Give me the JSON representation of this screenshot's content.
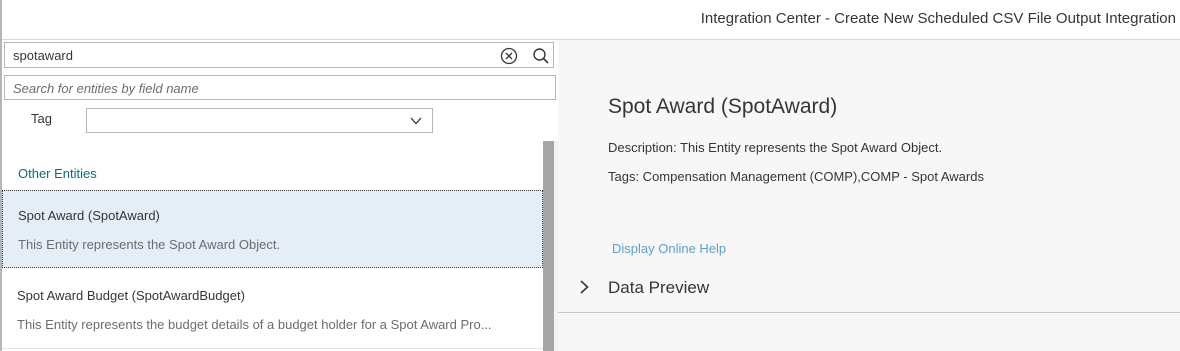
{
  "header": {
    "title": "Integration Center - Create New Scheduled CSV File Output Integration"
  },
  "search": {
    "value": "spotaward",
    "clear_icon": "clear-circle-icon",
    "search_icon": "search-icon"
  },
  "field_search": {
    "placeholder": "Search for entities by field name"
  },
  "tag_filter": {
    "label": "Tag",
    "value": "",
    "chevron_icon": "chevron-down-icon"
  },
  "list": {
    "section_header": "Other Entities",
    "items": [
      {
        "title": "Spot Award (SpotAward)",
        "description": "This Entity represents the Spot Award Object.",
        "selected": true
      },
      {
        "title": "Spot Award Budget (SpotAwardBudget)",
        "description": "This Entity represents the budget details of a budget holder for a Spot Award Pro...",
        "selected": false
      }
    ]
  },
  "detail": {
    "title": "Spot Award (SpotAward)",
    "description": "Description: This Entity represents the Spot Award Object.",
    "tags": "Tags: Compensation Management (COMP),COMP - Spot Awards",
    "help_link": "Display Online Help",
    "data_preview_label": "Data Preview",
    "data_preview_icon": "chevron-right-icon"
  },
  "colors": {
    "section_header": "#0a6e74",
    "link": "#5f9fcc",
    "selected_bg": "#e5eef6",
    "right_panel_bg": "#f7f7f7"
  }
}
